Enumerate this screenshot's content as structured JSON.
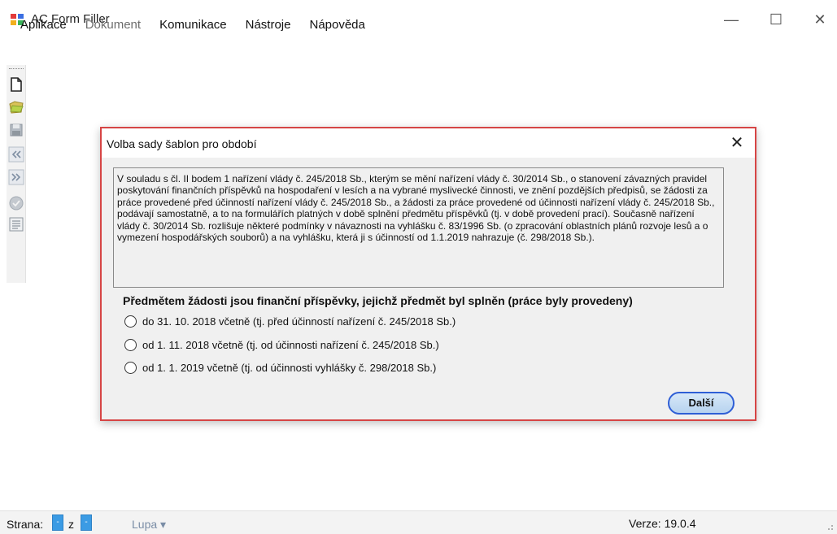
{
  "window": {
    "title": "AC Form Filler",
    "minimize_glyph": "—",
    "maximize_glyph": "☐",
    "close_glyph": "✕"
  },
  "menubar": {
    "items": [
      {
        "label": "Aplikace"
      },
      {
        "label": "Dokument",
        "disabled": true
      },
      {
        "label": "Komunikace"
      },
      {
        "label": "Nástroje"
      },
      {
        "label": "Nápověda"
      }
    ]
  },
  "toolbar": {
    "icons": [
      "new-document-icon",
      "open-folder-icon",
      "save-icon",
      "previous-page-icon",
      "next-page-icon",
      "ok-icon",
      "form-icon"
    ]
  },
  "dialog": {
    "title": "Volba sady šablon pro období",
    "close_glyph": "✕",
    "info_text": "V souladu s čl. II bodem 1 nařízení vlády č. 245/2018 Sb., kterým se mění nařízení vlády č. 30/2014 Sb., o stanovení závazných pravidel poskytování finančních příspěvků na hospodaření v lesích a na vybrané myslivecké činnosti, ve znění pozdějších předpisů, se žádosti za práce provedené před účinností nařízení vlády č. 245/2018 Sb., a žádosti za práce provedené od účinnosti nařízení vlády č. 245/2018 Sb., podávají samostatně, a to na formulářích platných v době splnění předmětu příspěvků (tj. v době provedení prací). Současně nařízení vlády č. 30/2014 Sb. rozlišuje některé podmínky v návaznosti na vyhlášku č. 83/1996 Sb. (o zpracování oblastních plánů rozvoje lesů a o vymezení hospodářských souborů) a na vyhlášku, která ji s účinností od 1.1.2019 nahrazuje (č. 298/2018 Sb.).",
    "question": "Předmětem žádosti jsou finanční příspěvky, jejichž předmět byl splněn (práce byly provedeny)",
    "options": [
      {
        "label": "do 31. 10. 2018 včetně (tj. před účinností nařízení č. 245/2018 Sb.)",
        "selected": false
      },
      {
        "label": "od 1. 11. 2018 včetně (tj. od účinnosti nařízení č. 245/2018 Sb.)",
        "selected": false
      },
      {
        "label": "od 1. 1. 2019 včetně (tj. od účinnosti vyhlášky č. 298/2018 Sb.)",
        "selected": false
      }
    ],
    "next_label": "Další"
  },
  "statusbar": {
    "page_label": "Strana:",
    "page_value": "-",
    "of_label": "z",
    "of_value": "-",
    "zoom_label": "Lupa ▾",
    "version": "Verze: 19.0.4"
  }
}
